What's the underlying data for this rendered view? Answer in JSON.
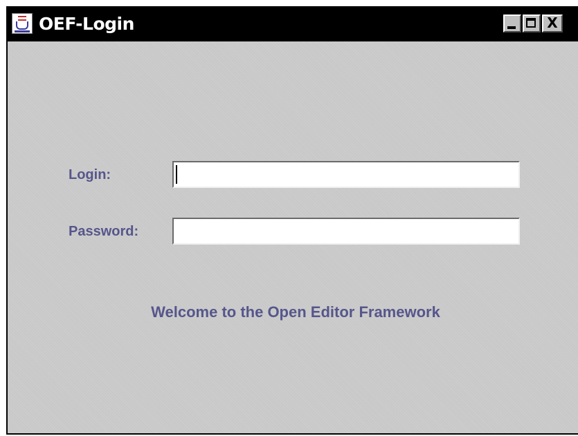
{
  "window": {
    "title": "OEF-Login",
    "icon": "java-coffee-cup-icon",
    "controls": {
      "minimize_icon": "minimize-icon",
      "maximize_icon": "maximize-icon",
      "close_label": "X"
    }
  },
  "form": {
    "login_label": "Login:",
    "login_value": "",
    "password_label": "Password:",
    "password_value": ""
  },
  "welcome_text": "Welcome to the Open Editor Framework",
  "colors": {
    "titlebar": "#000000",
    "title_text": "#ffffff",
    "background": "#c8c8c8",
    "label_text": "#56568c",
    "input_background": "#ffffff"
  }
}
